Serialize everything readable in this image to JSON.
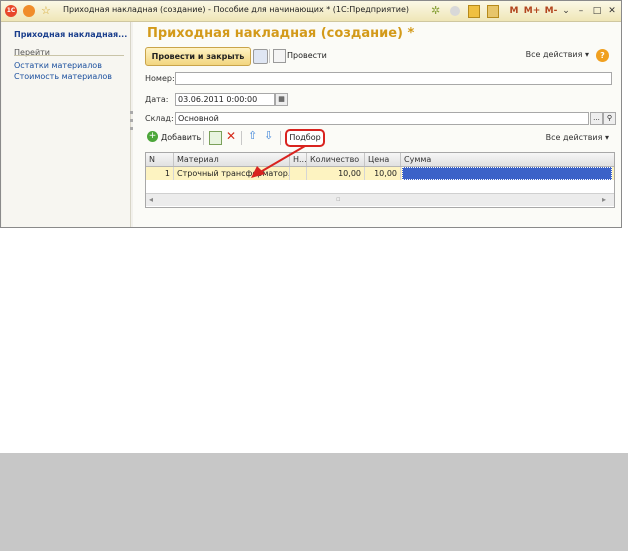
{
  "window": {
    "title": "Приходная накладная (создание) - Пособие для начинающих * (1С:Предприятие)",
    "app_icon": "1c-logo-icon",
    "title_buttons": [
      "M",
      "M+",
      "M-"
    ]
  },
  "sidebar": {
    "title": "Приходная накладная...",
    "section": "Перейти",
    "links": [
      "Остатки материалов",
      "Стоимость материалов"
    ]
  },
  "form": {
    "title": "Приходная накладная (создание) *",
    "post_close_label": "Провести и закрыть",
    "post_label": "Провести",
    "all_actions_label": "Все действия ▾",
    "help": "?",
    "number_label": "Номер:",
    "number_value": "",
    "date_label": "Дата:",
    "date_value": "03.06.2011  0:00:00",
    "warehouse_label": "Склад:",
    "warehouse_value": "Основной",
    "warehouse_select": "...",
    "add_label": "Добавить",
    "pick_label": "Подбор",
    "table_all_actions_label": "Все действия ▾"
  },
  "table": {
    "columns": [
      "N",
      "Материал",
      "Н...",
      "Количество",
      "Цена",
      "Сумма"
    ],
    "rows": [
      {
        "n": "1",
        "material": "Строчный трансформатор...",
        "h": "",
        "qty": "10,00",
        "price": "10,00",
        "sum": ""
      }
    ]
  },
  "colors": {
    "title_accent": "#d39a1a",
    "link": "#1a4f9e",
    "highlight_row": "#fdf3c1",
    "selected_cell": "#3b62c8",
    "annotation": "#d9231f"
  }
}
